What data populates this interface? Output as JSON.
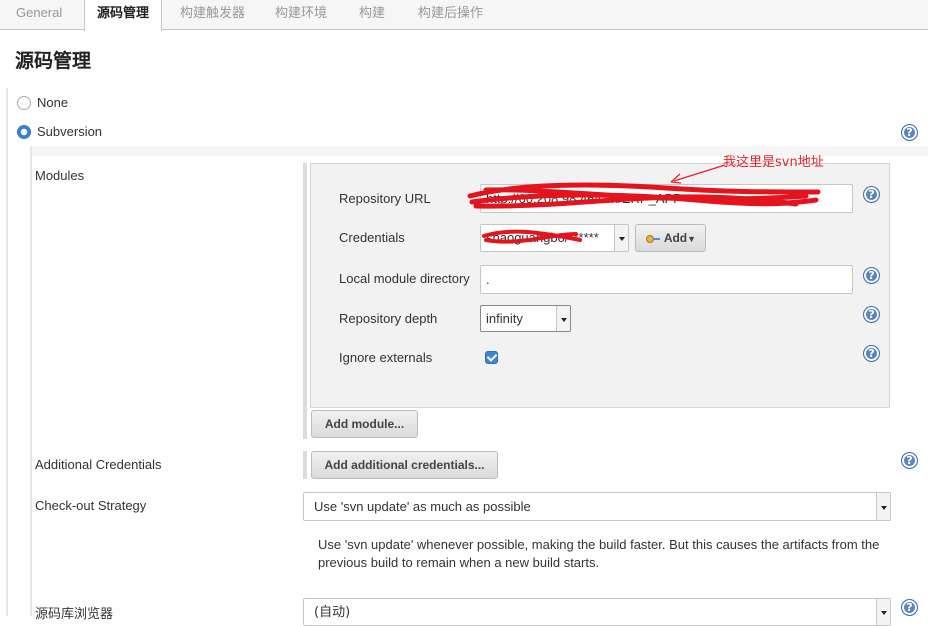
{
  "tabs": [
    {
      "label": "General"
    },
    {
      "label": "源码管理"
    },
    {
      "label": "构建触发器"
    },
    {
      "label": "构建环境"
    },
    {
      "label": "构建"
    },
    {
      "label": "构建后操作"
    }
  ],
  "section_title": "源码管理",
  "scm_options": {
    "none_label": "None",
    "svn_label": "Subversion",
    "selected": "Subversion"
  },
  "modules": {
    "label": "Modules",
    "annotation": "我这里是svn地址",
    "repository_url": {
      "label": "Repository URL",
      "value": "http://60.208.98.46/svn/ERP_APP"
    },
    "credentials": {
      "label": "Credentials",
      "value": "shaoguangbo/******",
      "add_label": "Add"
    },
    "local_module_directory": {
      "label": "Local module directory",
      "value": "."
    },
    "repository_depth": {
      "label": "Repository depth",
      "value": "infinity"
    },
    "ignore_externals": {
      "label": "Ignore externals",
      "checked": true
    },
    "add_module_label": "Add module..."
  },
  "additional_credentials": {
    "label": "Additional Credentials",
    "button_label": "Add additional credentials..."
  },
  "checkout_strategy": {
    "label": "Check-out Strategy",
    "value": "Use 'svn update' as much as possible",
    "description": "Use 'svn update' whenever possible, making the build faster. But this causes the artifacts from the previous build to remain when a new build starts."
  },
  "repo_browser": {
    "label": "源码库浏览器",
    "value": "(自动)"
  },
  "colors": {
    "accent": "#3c7fc9",
    "annotation": "#e3222c",
    "help": "#5b86bd"
  }
}
